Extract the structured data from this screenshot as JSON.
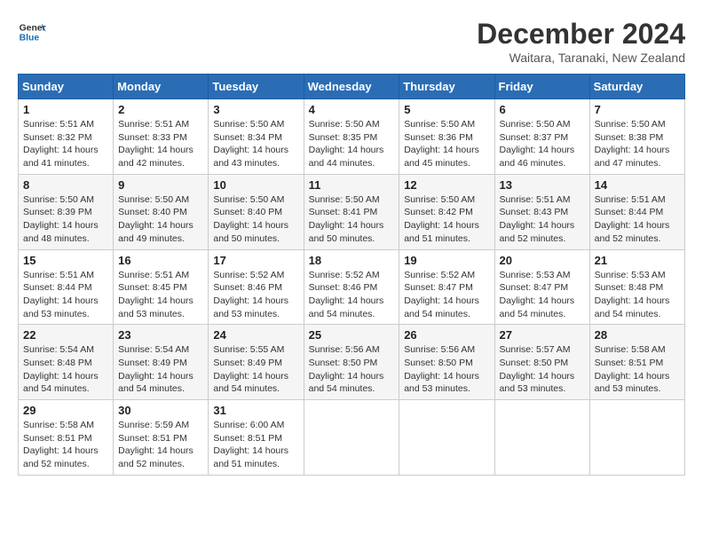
{
  "header": {
    "logo_general": "General",
    "logo_blue": "Blue",
    "month_title": "December 2024",
    "subtitle": "Waitara, Taranaki, New Zealand"
  },
  "days_of_week": [
    "Sunday",
    "Monday",
    "Tuesday",
    "Wednesday",
    "Thursday",
    "Friday",
    "Saturday"
  ],
  "weeks": [
    [
      {
        "day": "1",
        "sunrise": "5:51 AM",
        "sunset": "8:32 PM",
        "daylight": "14 hours and 41 minutes."
      },
      {
        "day": "2",
        "sunrise": "5:51 AM",
        "sunset": "8:33 PM",
        "daylight": "14 hours and 42 minutes."
      },
      {
        "day": "3",
        "sunrise": "5:50 AM",
        "sunset": "8:34 PM",
        "daylight": "14 hours and 43 minutes."
      },
      {
        "day": "4",
        "sunrise": "5:50 AM",
        "sunset": "8:35 PM",
        "daylight": "14 hours and 44 minutes."
      },
      {
        "day": "5",
        "sunrise": "5:50 AM",
        "sunset": "8:36 PM",
        "daylight": "14 hours and 45 minutes."
      },
      {
        "day": "6",
        "sunrise": "5:50 AM",
        "sunset": "8:37 PM",
        "daylight": "14 hours and 46 minutes."
      },
      {
        "day": "7",
        "sunrise": "5:50 AM",
        "sunset": "8:38 PM",
        "daylight": "14 hours and 47 minutes."
      }
    ],
    [
      {
        "day": "8",
        "sunrise": "5:50 AM",
        "sunset": "8:39 PM",
        "daylight": "14 hours and 48 minutes."
      },
      {
        "day": "9",
        "sunrise": "5:50 AM",
        "sunset": "8:40 PM",
        "daylight": "14 hours and 49 minutes."
      },
      {
        "day": "10",
        "sunrise": "5:50 AM",
        "sunset": "8:40 PM",
        "daylight": "14 hours and 50 minutes."
      },
      {
        "day": "11",
        "sunrise": "5:50 AM",
        "sunset": "8:41 PM",
        "daylight": "14 hours and 50 minutes."
      },
      {
        "day": "12",
        "sunrise": "5:50 AM",
        "sunset": "8:42 PM",
        "daylight": "14 hours and 51 minutes."
      },
      {
        "day": "13",
        "sunrise": "5:51 AM",
        "sunset": "8:43 PM",
        "daylight": "14 hours and 52 minutes."
      },
      {
        "day": "14",
        "sunrise": "5:51 AM",
        "sunset": "8:44 PM",
        "daylight": "14 hours and 52 minutes."
      }
    ],
    [
      {
        "day": "15",
        "sunrise": "5:51 AM",
        "sunset": "8:44 PM",
        "daylight": "14 hours and 53 minutes."
      },
      {
        "day": "16",
        "sunrise": "5:51 AM",
        "sunset": "8:45 PM",
        "daylight": "14 hours and 53 minutes."
      },
      {
        "day": "17",
        "sunrise": "5:52 AM",
        "sunset": "8:46 PM",
        "daylight": "14 hours and 53 minutes."
      },
      {
        "day": "18",
        "sunrise": "5:52 AM",
        "sunset": "8:46 PM",
        "daylight": "14 hours and 54 minutes."
      },
      {
        "day": "19",
        "sunrise": "5:52 AM",
        "sunset": "8:47 PM",
        "daylight": "14 hours and 54 minutes."
      },
      {
        "day": "20",
        "sunrise": "5:53 AM",
        "sunset": "8:47 PM",
        "daylight": "14 hours and 54 minutes."
      },
      {
        "day": "21",
        "sunrise": "5:53 AM",
        "sunset": "8:48 PM",
        "daylight": "14 hours and 54 minutes."
      }
    ],
    [
      {
        "day": "22",
        "sunrise": "5:54 AM",
        "sunset": "8:48 PM",
        "daylight": "14 hours and 54 minutes."
      },
      {
        "day": "23",
        "sunrise": "5:54 AM",
        "sunset": "8:49 PM",
        "daylight": "14 hours and 54 minutes."
      },
      {
        "day": "24",
        "sunrise": "5:55 AM",
        "sunset": "8:49 PM",
        "daylight": "14 hours and 54 minutes."
      },
      {
        "day": "25",
        "sunrise": "5:56 AM",
        "sunset": "8:50 PM",
        "daylight": "14 hours and 54 minutes."
      },
      {
        "day": "26",
        "sunrise": "5:56 AM",
        "sunset": "8:50 PM",
        "daylight": "14 hours and 53 minutes."
      },
      {
        "day": "27",
        "sunrise": "5:57 AM",
        "sunset": "8:50 PM",
        "daylight": "14 hours and 53 minutes."
      },
      {
        "day": "28",
        "sunrise": "5:58 AM",
        "sunset": "8:51 PM",
        "daylight": "14 hours and 53 minutes."
      }
    ],
    [
      {
        "day": "29",
        "sunrise": "5:58 AM",
        "sunset": "8:51 PM",
        "daylight": "14 hours and 52 minutes."
      },
      {
        "day": "30",
        "sunrise": "5:59 AM",
        "sunset": "8:51 PM",
        "daylight": "14 hours and 52 minutes."
      },
      {
        "day": "31",
        "sunrise": "6:00 AM",
        "sunset": "8:51 PM",
        "daylight": "14 hours and 51 minutes."
      },
      null,
      null,
      null,
      null
    ]
  ]
}
